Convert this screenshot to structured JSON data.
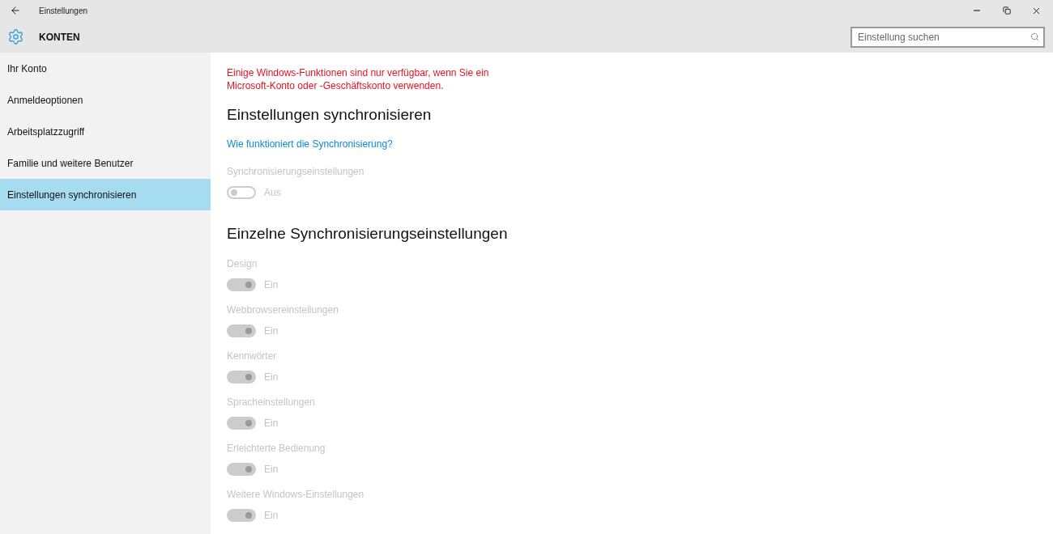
{
  "window": {
    "title": "Einstellungen"
  },
  "header": {
    "title": "KONTEN",
    "search": {
      "placeholder": "Einstellung suchen"
    }
  },
  "sidebar": {
    "items": [
      {
        "label": "Ihr Konto",
        "selected": false
      },
      {
        "label": "Anmeldeoptionen",
        "selected": false
      },
      {
        "label": "Arbeitsplatzzugriff",
        "selected": false
      },
      {
        "label": "Familie und weitere Benutzer",
        "selected": false
      },
      {
        "label": "Einstellungen synchronisieren",
        "selected": true
      }
    ]
  },
  "warning": "Einige Windows-Funktionen sind nur verfügbar, wenn Sie ein Microsoft-Konto oder -Geschäftskonto verwenden.",
  "section1": {
    "heading": "Einstellungen synchronisieren",
    "link": "Wie funktioniert die Synchronisierung?",
    "setting": {
      "label": "Synchronisierungseinstellungen",
      "on": false,
      "disabled": true,
      "state_text": "Aus"
    }
  },
  "section2": {
    "heading": "Einzelne Synchronisierungseinstellungen",
    "settings": [
      {
        "label": "Design",
        "on": true,
        "disabled": true,
        "state_text": "Ein"
      },
      {
        "label": "Webbrowsereinstellungen",
        "on": true,
        "disabled": true,
        "state_text": "Ein"
      },
      {
        "label": "Kennwörter",
        "on": true,
        "disabled": true,
        "state_text": "Ein"
      },
      {
        "label": "Spracheinstellungen",
        "on": true,
        "disabled": true,
        "state_text": "Ein"
      },
      {
        "label": "Erleichterte Bedienung",
        "on": true,
        "disabled": true,
        "state_text": "Ein"
      },
      {
        "label": "Weitere Windows-Einstellungen",
        "on": true,
        "disabled": true,
        "state_text": "Ein"
      }
    ]
  }
}
